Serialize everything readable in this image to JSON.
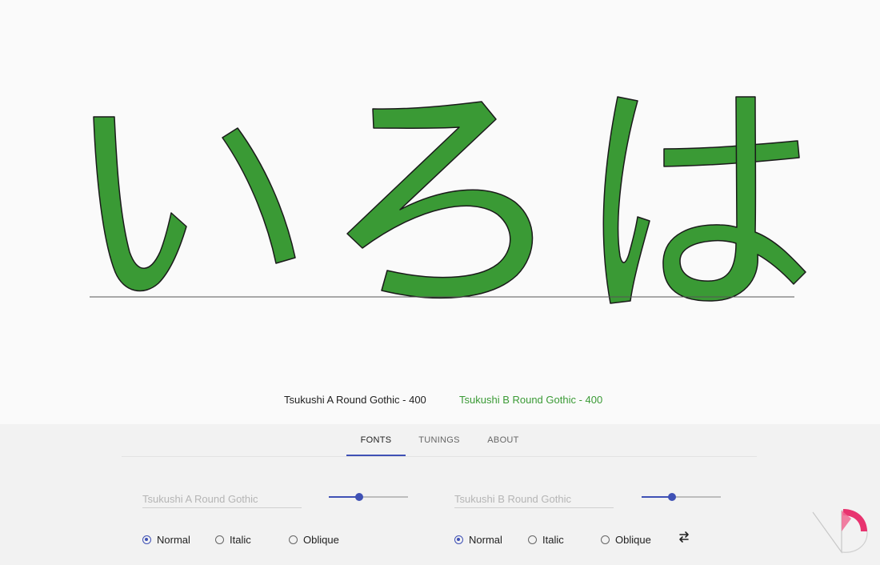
{
  "preview": {
    "glyphs": [
      "い",
      "ろ",
      "は"
    ],
    "glyph_fill": "#3a9a35",
    "glyph_stroke": "#1a1a1a"
  },
  "font_names": {
    "a": "Tsukushi A Round Gothic - 400",
    "b": "Tsukushi B Round Gothic - 400"
  },
  "tabs": [
    {
      "label": "FONTS",
      "active": true
    },
    {
      "label": "TUNINGS",
      "active": false
    },
    {
      "label": "ABOUT",
      "active": false
    }
  ],
  "font_a": {
    "placeholder": "Tsukushi A Round Gothic",
    "value": "",
    "weight_fraction": 0.38,
    "styles": [
      {
        "label": "Normal",
        "checked": true
      },
      {
        "label": "Italic",
        "checked": false
      },
      {
        "label": "Oblique",
        "checked": false
      }
    ]
  },
  "font_b": {
    "placeholder": "Tsukushi B Round Gothic",
    "value": "",
    "weight_fraction": 0.38,
    "styles": [
      {
        "label": "Normal",
        "checked": true
      },
      {
        "label": "Italic",
        "checked": false
      },
      {
        "label": "Oblique",
        "checked": false
      }
    ]
  },
  "icons": {
    "swap": "swap-arrows-icon",
    "logo": "app-logo-icon"
  },
  "colors": {
    "accent": "#3f51b5",
    "font_b_label": "#3a9a35",
    "logo_pink": "#e8336f"
  }
}
